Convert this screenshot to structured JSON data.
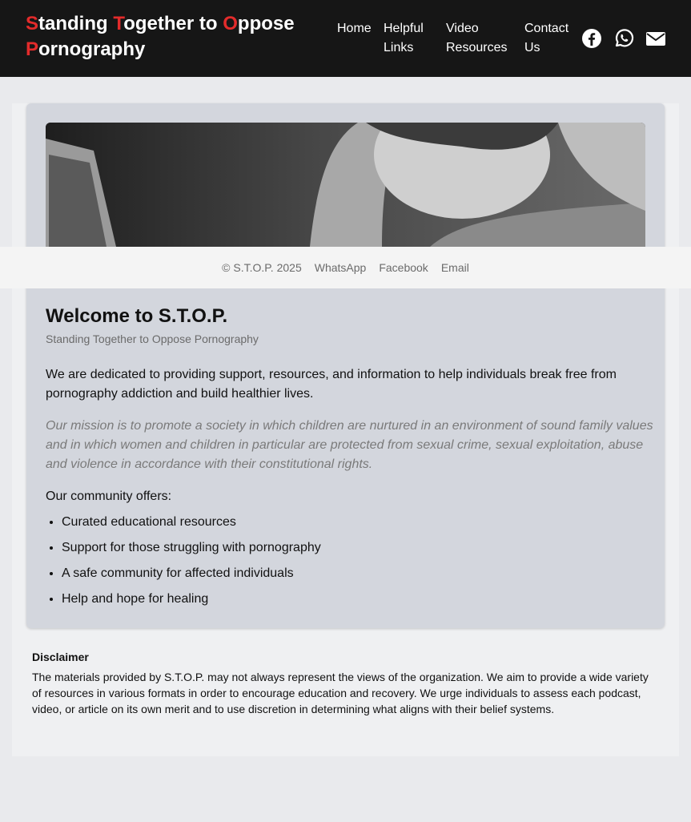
{
  "header": {
    "logo": {
      "w1_first": "S",
      "w1_rest": "tanding",
      "w2_first": "T",
      "w2_rest": "ogether to",
      "w3_first": "O",
      "w3_rest": "ppose",
      "w4_first": "P",
      "w4_rest": "ornography"
    },
    "nav": {
      "home": "Home",
      "helpful_links_1": "Helpful",
      "helpful_links_2": "Links",
      "video_resources_1": "Video",
      "video_resources_2": "Resources",
      "contact_us_1": "Contact",
      "contact_us_2": "Us"
    },
    "social_icons": [
      "facebook-icon",
      "whatsapp-icon",
      "email-icon"
    ]
  },
  "footer": {
    "copyright": "© S.T.O.P. 2025",
    "links": [
      "WhatsApp",
      "Facebook",
      "Email"
    ]
  },
  "main": {
    "title": "Welcome to S.T.O.P.",
    "subtitle": "Standing Together to Oppose Pornography",
    "intro": "We are dedicated to providing support, resources, and information to help individuals break free from pornography addiction and build healthier lives.",
    "mission": "Our mission is to promote a society in which children are nurtured in an environment of sound family values and in which women and children in particular are protected from sexual crime, sexual exploitation, abuse and violence in accordance with their constitutional rights.",
    "offers_label": "Our community offers:",
    "offers": [
      "Curated educational resources",
      "Support for those struggling with pornography",
      "A safe community for affected individuals",
      "Help and hope for healing"
    ]
  },
  "disclaimer": {
    "title": "Disclaimer",
    "text": "The materials provided by S.T.O.P. may not always represent the views of the organization. We aim to provide a wide variety of resources in various formats in order to encourage education and recovery. We urge individuals to assess each podcast, video, or article on its own merit and to use discretion in determining what aligns with their belief systems."
  },
  "colors": {
    "header_bg": "#161616",
    "logo_accent": "#e32b2b",
    "card_bg": "#d3d6dd"
  }
}
